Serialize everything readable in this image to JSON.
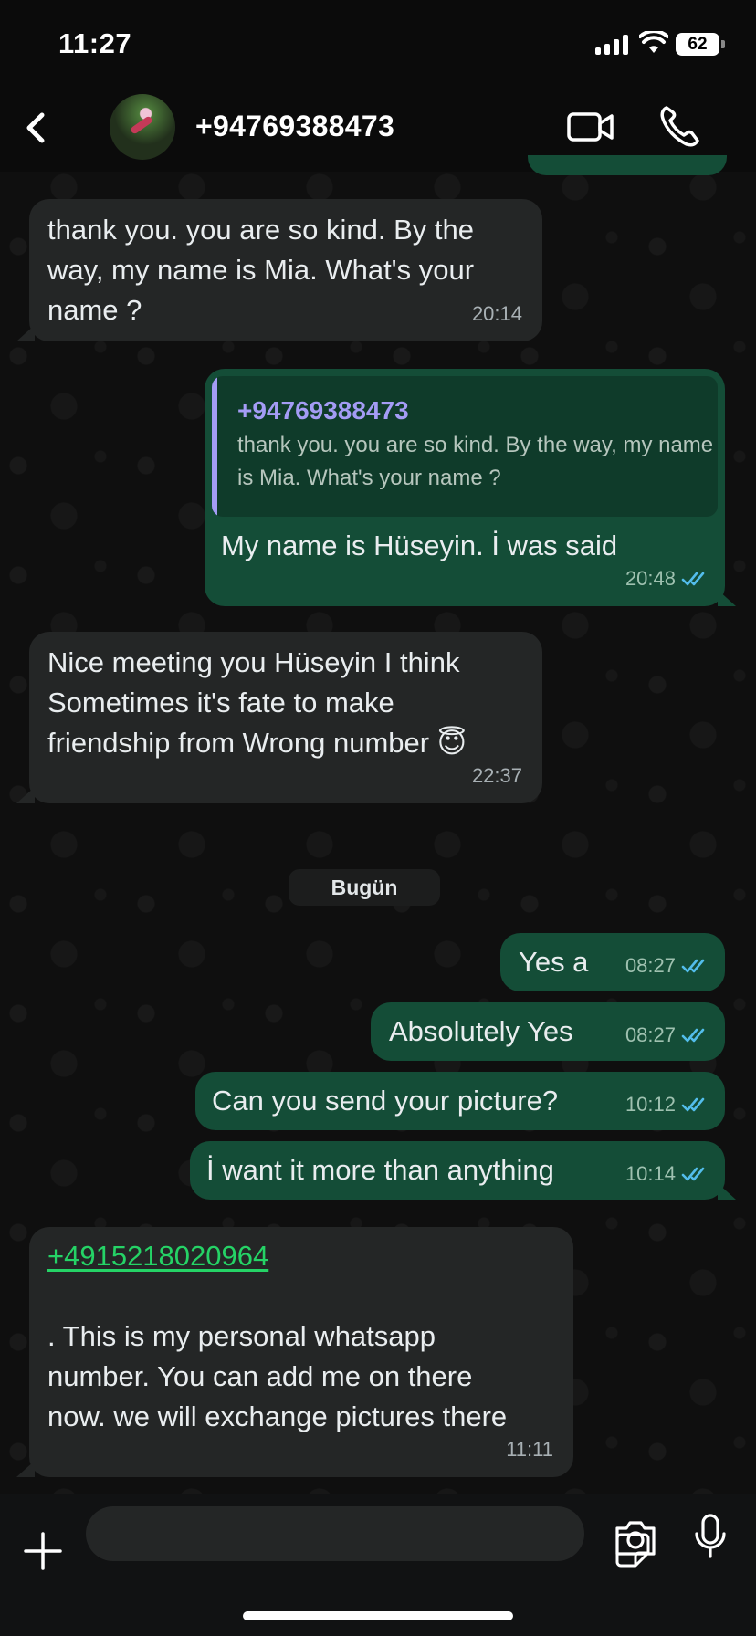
{
  "status_bar": {
    "time": "11:27",
    "battery": "62"
  },
  "header": {
    "contact_name": "+94769388473",
    "icons": {
      "back": "chevron-left-icon",
      "video": "video-camera-icon",
      "call": "phone-icon"
    }
  },
  "messages": [
    {
      "direction": "incoming",
      "lines": [
        "thank you. you are so kind. By the",
        "way, my name is Mia. What's your",
        "name ?"
      ],
      "time": "20:14"
    },
    {
      "direction": "outgoing",
      "quote": {
        "author": "+94769388473",
        "text": "thank you. you are so kind. By the way, my name is Mia. What's your name ?"
      },
      "text": "My name is Hüseyin. İ was said",
      "time": "20:48",
      "status": "read"
    },
    {
      "direction": "incoming",
      "lines": [
        "Nice meeting you Hüseyin I think",
        "Sometimes it's fate to make",
        "friendship from Wrong number 😇"
      ],
      "time": "22:37"
    },
    {
      "direction": "outgoing",
      "text": "Yes a",
      "time": "08:27",
      "status": "read"
    },
    {
      "direction": "outgoing",
      "text": "Absolutely Yes",
      "time": "08:27",
      "status": "read"
    },
    {
      "direction": "outgoing",
      "text": "Can you send your picture?",
      "time": "10:12",
      "status": "read"
    },
    {
      "direction": "outgoing",
      "text": "İ want it more than anything",
      "time": "10:14",
      "status": "read"
    },
    {
      "direction": "incoming",
      "link": "+4915218020964",
      "lines": [
        ". This is my personal whatsapp",
        "number. You can add me on there",
        "now. we will exchange pictures there"
      ],
      "time": "11:11"
    }
  ],
  "day_separator": "Bugün",
  "input_bar": {
    "placeholder": "",
    "icons": [
      "plus-icon",
      "sticker-icon",
      "camera-icon",
      "microphone-icon"
    ]
  },
  "colors": {
    "incoming_bubble": "#242626",
    "outgoing_bubble": "#144d37",
    "read_ticks": "#53bdeb",
    "link": "#25d366",
    "quote_accent": "#a49cf5"
  }
}
